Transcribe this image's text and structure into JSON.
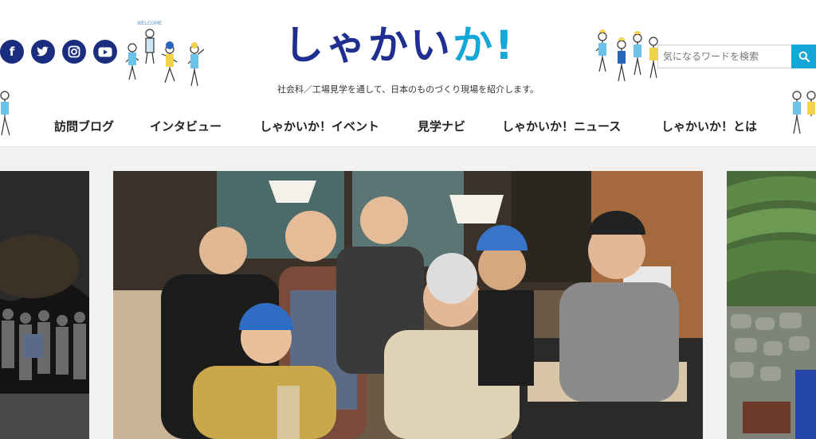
{
  "header": {
    "logo_main": "しゃかい",
    "logo_accent": "か!",
    "tagline": "社会科／工場見学を通して、日本のものづくり現場を紹介します。",
    "welcome_text": "WELCOME"
  },
  "social": {
    "icons": [
      "facebook-icon",
      "twitter-icon",
      "instagram-icon",
      "youtube-icon"
    ],
    "facebook_glyph": "f",
    "twitter_glyph": "t",
    "instagram_glyph": "◎",
    "youtube_glyph": "▶"
  },
  "search": {
    "placeholder": "気になるワードを検索",
    "button_icon": "search-icon"
  },
  "nav": {
    "items": [
      {
        "label": "訪問ブログ"
      },
      {
        "label": "インタビュー"
      },
      {
        "label": "しゃかいか！イベント"
      },
      {
        "label": "見学ナビ"
      },
      {
        "label": "しゃかいか！ニュース"
      },
      {
        "label": "しゃかいか！とは"
      }
    ]
  },
  "colors": {
    "brand_navy": "#1e2f8f",
    "brand_cyan": "#14a7d8",
    "social_bg": "#1b2d7f",
    "page_bg": "#f1f1f1"
  }
}
